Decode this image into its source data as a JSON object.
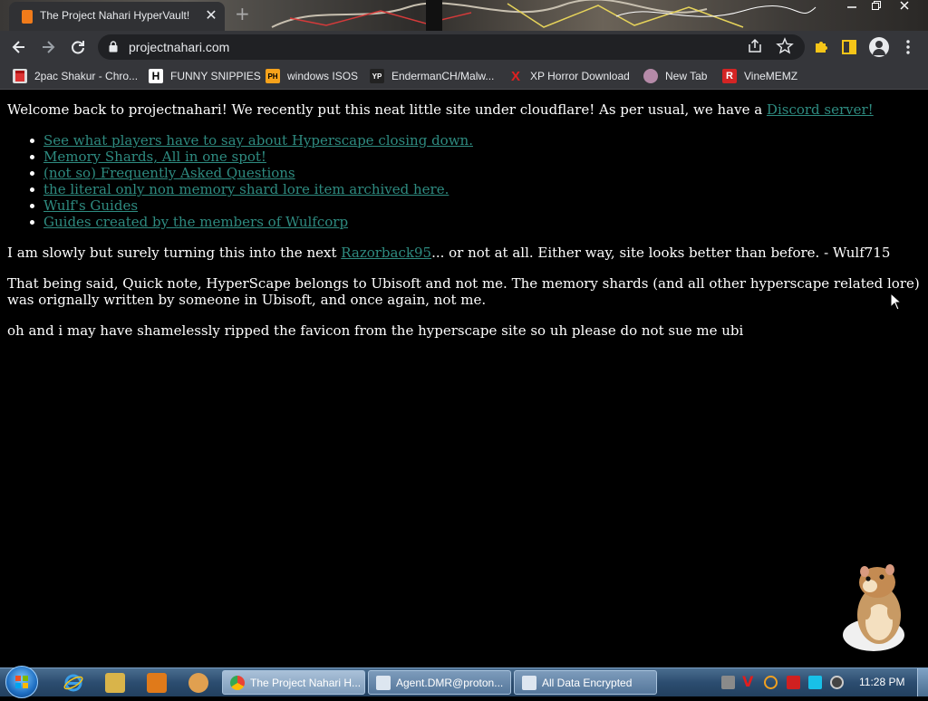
{
  "browser": {
    "tab_title": "The Project Nahari HyperVault!",
    "tab_close": "✕",
    "new_tab": "+",
    "url": "projectnahari.com"
  },
  "bookmarks": [
    {
      "label": "2pac Shakur - Chro...",
      "icon": "calendar-icon"
    },
    {
      "label": "FUNNY SNIPPIES",
      "icon": "h-logo-icon"
    },
    {
      "label": "windows ISOS",
      "icon": "ph-logo-icon"
    },
    {
      "label": "EndermanCH/Malw...",
      "icon": "yp-logo-icon"
    },
    {
      "label": "XP Horror Download",
      "icon": "x-logo-icon"
    },
    {
      "label": "New Tab",
      "icon": "globe-icon"
    },
    {
      "label": "VineMEMZ",
      "icon": "r-logo-icon"
    }
  ],
  "page": {
    "intro_text": "Welcome back to projectnahari! We recently put this neat little site under cloudflare! As per usual, we have a ",
    "discord_link": "Discord server!",
    "links": [
      "See what players have to say about Hyperscape closing down.",
      "Memory Shards, All in one spot!",
      "(not so) Frequently Asked Questions",
      "the literal only non memory shard lore item archived here.",
      "Wulf's Guides",
      "Guides created by the members of Wulfcorp"
    ],
    "para2_before": "I am slowly but surely turning this into the next ",
    "para2_link": "Razorback95",
    "para2_after": "... or not at all. Either way, site looks better than before. - Wulf715",
    "para3": "That being said, Quick note, HyperScape belongs to Ubisoft and not me. The memory shards (and all other hyperscape related lore) was orignally written by someone in Ubisoft, and once again, not me.",
    "para4": "oh and i may have shamelessly ripped the favicon from the hyperscape site so uh please do not sue me ubi"
  },
  "taskbar": {
    "tasks": [
      {
        "label": "The Project Nahari H...",
        "active": true
      },
      {
        "label": "Agent.DMR@proton...",
        "active": false
      },
      {
        "label": "All Data Encrypted",
        "active": false
      }
    ],
    "clock": "11:28 PM"
  },
  "colors": {
    "link": "#2e8b80",
    "page_bg": "#000000",
    "toolbar_bg": "#35363a"
  }
}
